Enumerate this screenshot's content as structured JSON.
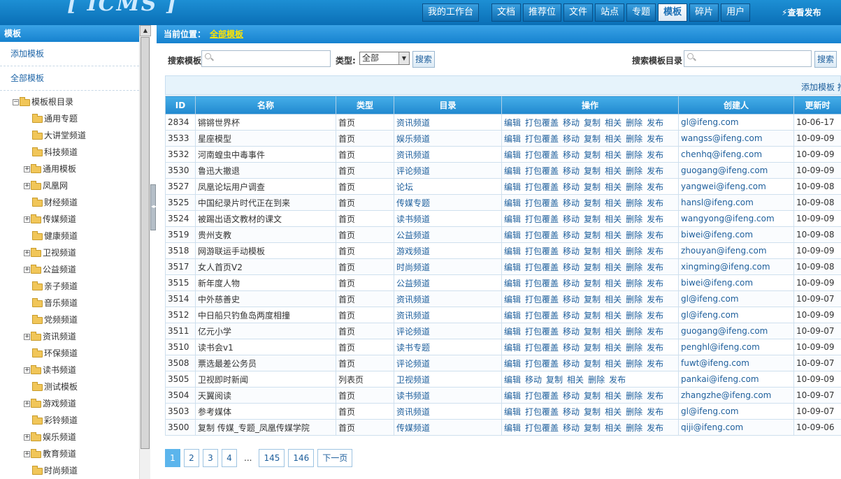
{
  "app": {
    "logo": "[ ICMS ]"
  },
  "nav": {
    "workbench": "我的工作台",
    "items": [
      "文档",
      "推荐位",
      "文件",
      "站点",
      "专题",
      "模板",
      "碎片",
      "用户"
    ],
    "active": "模板",
    "view_publish": "查看发布"
  },
  "sidebar": {
    "title": "模板",
    "links": [
      "添加模板",
      "全部模板"
    ],
    "tree_root": "模板根目录",
    "tree": [
      {
        "label": "通用专题",
        "exp": false
      },
      {
        "label": "大讲堂频道",
        "exp": false
      },
      {
        "label": "科技频道",
        "exp": false
      },
      {
        "label": "通用模板",
        "exp": true
      },
      {
        "label": "凤凰网",
        "exp": true
      },
      {
        "label": "财经频道",
        "exp": false
      },
      {
        "label": "传媒频道",
        "exp": true
      },
      {
        "label": "健康频道",
        "exp": false
      },
      {
        "label": "卫视频道",
        "exp": true
      },
      {
        "label": "公益频道",
        "exp": true
      },
      {
        "label": "亲子频道",
        "exp": false
      },
      {
        "label": "音乐频道",
        "exp": false
      },
      {
        "label": "党频频道",
        "exp": false
      },
      {
        "label": "资讯频道",
        "exp": true
      },
      {
        "label": "环保频道",
        "exp": false
      },
      {
        "label": "读书频道",
        "exp": true
      },
      {
        "label": "测试模板",
        "exp": false
      },
      {
        "label": "游戏频道",
        "exp": true
      },
      {
        "label": "彩铃频道",
        "exp": false
      },
      {
        "label": "娱乐频道",
        "exp": true
      },
      {
        "label": "教育频道",
        "exp": true
      },
      {
        "label": "时尚频道",
        "exp": false
      }
    ]
  },
  "breadcrumb": {
    "label": "当前位置：",
    "current": "全部模板"
  },
  "search": {
    "template_label": "搜索模板",
    "type_label": "类型:",
    "type_value": "全部",
    "button": "搜索",
    "dir_label": "搜索模板目录",
    "dir_button": "搜索"
  },
  "toolbar": {
    "add_template": "添加模板 推"
  },
  "table": {
    "headers": [
      "ID",
      "名称",
      "类型",
      "目录",
      "操作",
      "创建人",
      "更新时"
    ],
    "ops_full": [
      "编辑",
      "打包覆盖",
      "移动",
      "复制",
      "相关",
      "删除",
      "发布"
    ],
    "ops_short": [
      "编辑",
      "移动",
      "复制",
      "相关",
      "删除",
      "发布"
    ],
    "rows": [
      {
        "id": "2834",
        "name": "锵锵世界杯",
        "type": "首页",
        "dir": "资讯频道",
        "ops": "full",
        "creator": "gl@ifeng.com",
        "updated": "10-06-17"
      },
      {
        "id": "3533",
        "name": "星座模型",
        "type": "首页",
        "dir": "娱乐频道",
        "ops": "full",
        "creator": "wangss@ifeng.com",
        "updated": "10-09-09"
      },
      {
        "id": "3532",
        "name": "河南蝗虫中毒事件",
        "type": "首页",
        "dir": "资讯频道",
        "ops": "full",
        "creator": "chenhq@ifeng.com",
        "updated": "10-09-09"
      },
      {
        "id": "3530",
        "name": "鲁迅大撤退",
        "type": "首页",
        "dir": "评论频道",
        "ops": "full",
        "creator": "guogang@ifeng.com",
        "updated": "10-09-09"
      },
      {
        "id": "3527",
        "name": "凤凰论坛用户调查",
        "type": "首页",
        "dir": "论坛",
        "ops": "full",
        "creator": "yangwei@ifeng.com",
        "updated": "10-09-08"
      },
      {
        "id": "3525",
        "name": "中国纪录片时代正在到来",
        "type": "首页",
        "dir": "传媒专题",
        "ops": "full",
        "creator": "hansl@ifeng.com",
        "updated": "10-09-08"
      },
      {
        "id": "3524",
        "name": "被踢出语文教材的课文",
        "type": "首页",
        "dir": "读书频道",
        "ops": "full",
        "creator": "wangyong@ifeng.com",
        "updated": "10-09-09"
      },
      {
        "id": "3519",
        "name": "贵州支教",
        "type": "首页",
        "dir": "公益频道",
        "ops": "full",
        "creator": "biwei@ifeng.com",
        "updated": "10-09-08"
      },
      {
        "id": "3518",
        "name": "网游联运手动模板",
        "type": "首页",
        "dir": "游戏频道",
        "ops": "full",
        "creator": "zhouyan@ifeng.com",
        "updated": "10-09-09"
      },
      {
        "id": "3517",
        "name": "女人首页V2",
        "type": "首页",
        "dir": "时尚频道",
        "ops": "full",
        "creator": "xingming@ifeng.com",
        "updated": "10-09-08"
      },
      {
        "id": "3515",
        "name": "新年度人物",
        "type": "首页",
        "dir": "公益频道",
        "ops": "full",
        "creator": "biwei@ifeng.com",
        "updated": "10-09-09"
      },
      {
        "id": "3514",
        "name": "中外慈善史",
        "type": "首页",
        "dir": "资讯频道",
        "ops": "full",
        "creator": "gl@ifeng.com",
        "updated": "10-09-07"
      },
      {
        "id": "3512",
        "name": "中日船只钓鱼岛两度相撞",
        "type": "首页",
        "dir": "资讯频道",
        "ops": "full",
        "creator": "gl@ifeng.com",
        "updated": "10-09-09"
      },
      {
        "id": "3511",
        "name": "亿元小学",
        "type": "首页",
        "dir": "评论频道",
        "ops": "full",
        "creator": "guogang@ifeng.com",
        "updated": "10-09-07"
      },
      {
        "id": "3510",
        "name": "读书会v1",
        "type": "首页",
        "dir": "读书专题",
        "ops": "full",
        "creator": "penghl@ifeng.com",
        "updated": "10-09-09"
      },
      {
        "id": "3508",
        "name": "票选最差公务员",
        "type": "首页",
        "dir": "评论频道",
        "ops": "full",
        "creator": "fuwt@ifeng.com",
        "updated": "10-09-07"
      },
      {
        "id": "3505",
        "name": "卫视即时新闻",
        "type": "列表页",
        "dir": "卫视频道",
        "ops": "short",
        "creator": "pankai@ifeng.com",
        "updated": "10-09-09"
      },
      {
        "id": "3504",
        "name": "天翼阅读",
        "type": "首页",
        "dir": "读书频道",
        "ops": "full",
        "creator": "zhangzhe@ifeng.com",
        "updated": "10-09-07"
      },
      {
        "id": "3503",
        "name": "参考媒体",
        "type": "首页",
        "dir": "资讯频道",
        "ops": "full",
        "creator": "gl@ifeng.com",
        "updated": "10-09-07"
      },
      {
        "id": "3500",
        "name": "复制 传媒_专题_凤凰传媒学院",
        "type": "首页",
        "dir": "传媒频道",
        "ops": "full",
        "creator": "qiji@ifeng.com",
        "updated": "10-09-06"
      }
    ]
  },
  "pager": {
    "pages": [
      "1",
      "2",
      "3",
      "4"
    ],
    "dots": "...",
    "tail": [
      "145",
      "146"
    ],
    "next": "下一页",
    "current": "1"
  }
}
